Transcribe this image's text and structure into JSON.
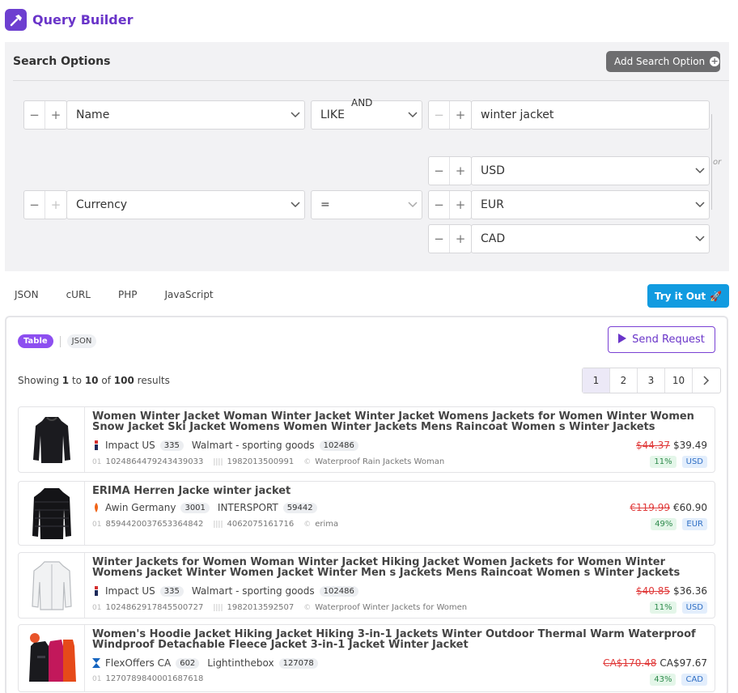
{
  "app": {
    "title": "Query Builder"
  },
  "search_options": {
    "title": "Search Options",
    "add_label": "Add Search Option",
    "rows": [
      {
        "field": "Name",
        "operator": "LIKE",
        "values": [
          "winter jacket"
        ]
      },
      {
        "field": "Currency",
        "operator": "=",
        "values": [
          "USD",
          "EUR",
          "CAD"
        ]
      }
    ],
    "joiner": "AND",
    "or_label": "or"
  },
  "code_tabs": [
    "JSON",
    "cURL",
    "PHP",
    "JavaScript"
  ],
  "try_label": "Try it Out",
  "results": {
    "view_table": "Table",
    "view_json": "JSON",
    "send_label": "Send Request",
    "showing": {
      "prefix": "Showing",
      "from": "1",
      "to_word": "to",
      "to": "10",
      "of_word": "of",
      "total": "100",
      "suffix": "results"
    },
    "pages": [
      "1",
      "2",
      "3",
      "10"
    ],
    "current_page": "1",
    "products": [
      {
        "title": "Women Winter Jacket Woman Winter Jacket Winter Jacket Womens Jackets for Women Winter Women Snow Jacket Ski Jacket Womens Women Winter Jackets Mens Raincoat Women s Winter Jackets",
        "network": "Impact US",
        "network_count": "335",
        "merchant": "Walmart - sporting goods",
        "merchant_count": "102486",
        "id": "1024864479243439033",
        "gtin": "1982013500991",
        "category": "Waterproof Rain Jackets Woman",
        "old_price": "$44.37",
        "price": "$39.49",
        "discount": "11%",
        "currency": "USD"
      },
      {
        "title": "ERIMA Herren Jacke winter jacket",
        "network": "Awin Germany",
        "network_count": "3001",
        "merchant": "INTERSPORT",
        "merchant_count": "59442",
        "id": "8594420037653364842",
        "gtin": "4062075161716",
        "category": "erima",
        "old_price": "€119.99",
        "price": "€60.90",
        "discount": "49%",
        "currency": "EUR"
      },
      {
        "title": "Winter Jackets for Women Woman Winter Jacket Hiking Jacket Women Jackets for Women Winter Womens Jacket Winter Women Jacket Winter Men s Jackets Mens Raincoat Women s Winter Jackets",
        "network": "Impact US",
        "network_count": "335",
        "merchant": "Walmart - sporting goods",
        "merchant_count": "102486",
        "id": "1024862917845500727",
        "gtin": "1982013592507",
        "category": "Waterproof Winter Jackets for Women",
        "old_price": "$40.85",
        "price": "$36.36",
        "discount": "11%",
        "currency": "USD"
      },
      {
        "title": "Women's Hoodie Jacket Hiking Jacket Hiking 3-in-1 Jackets Winter Outdoor Thermal Warm Waterproof Windproof Detachable Fleece Jacket 3-in-1 Jacket Winter Jacket",
        "network": "FlexOffers CA",
        "network_count": "602",
        "merchant": "Lightinthebox",
        "merchant_count": "127078",
        "id": "1270789840001687618",
        "old_price": "CA$170.48",
        "price": "CA$97.67",
        "discount": "43%",
        "currency": "CAD"
      }
    ]
  },
  "colors": {
    "brand": "#6d3fd0",
    "accent_blue": "#119be0",
    "price_old": "#e03a3a"
  }
}
